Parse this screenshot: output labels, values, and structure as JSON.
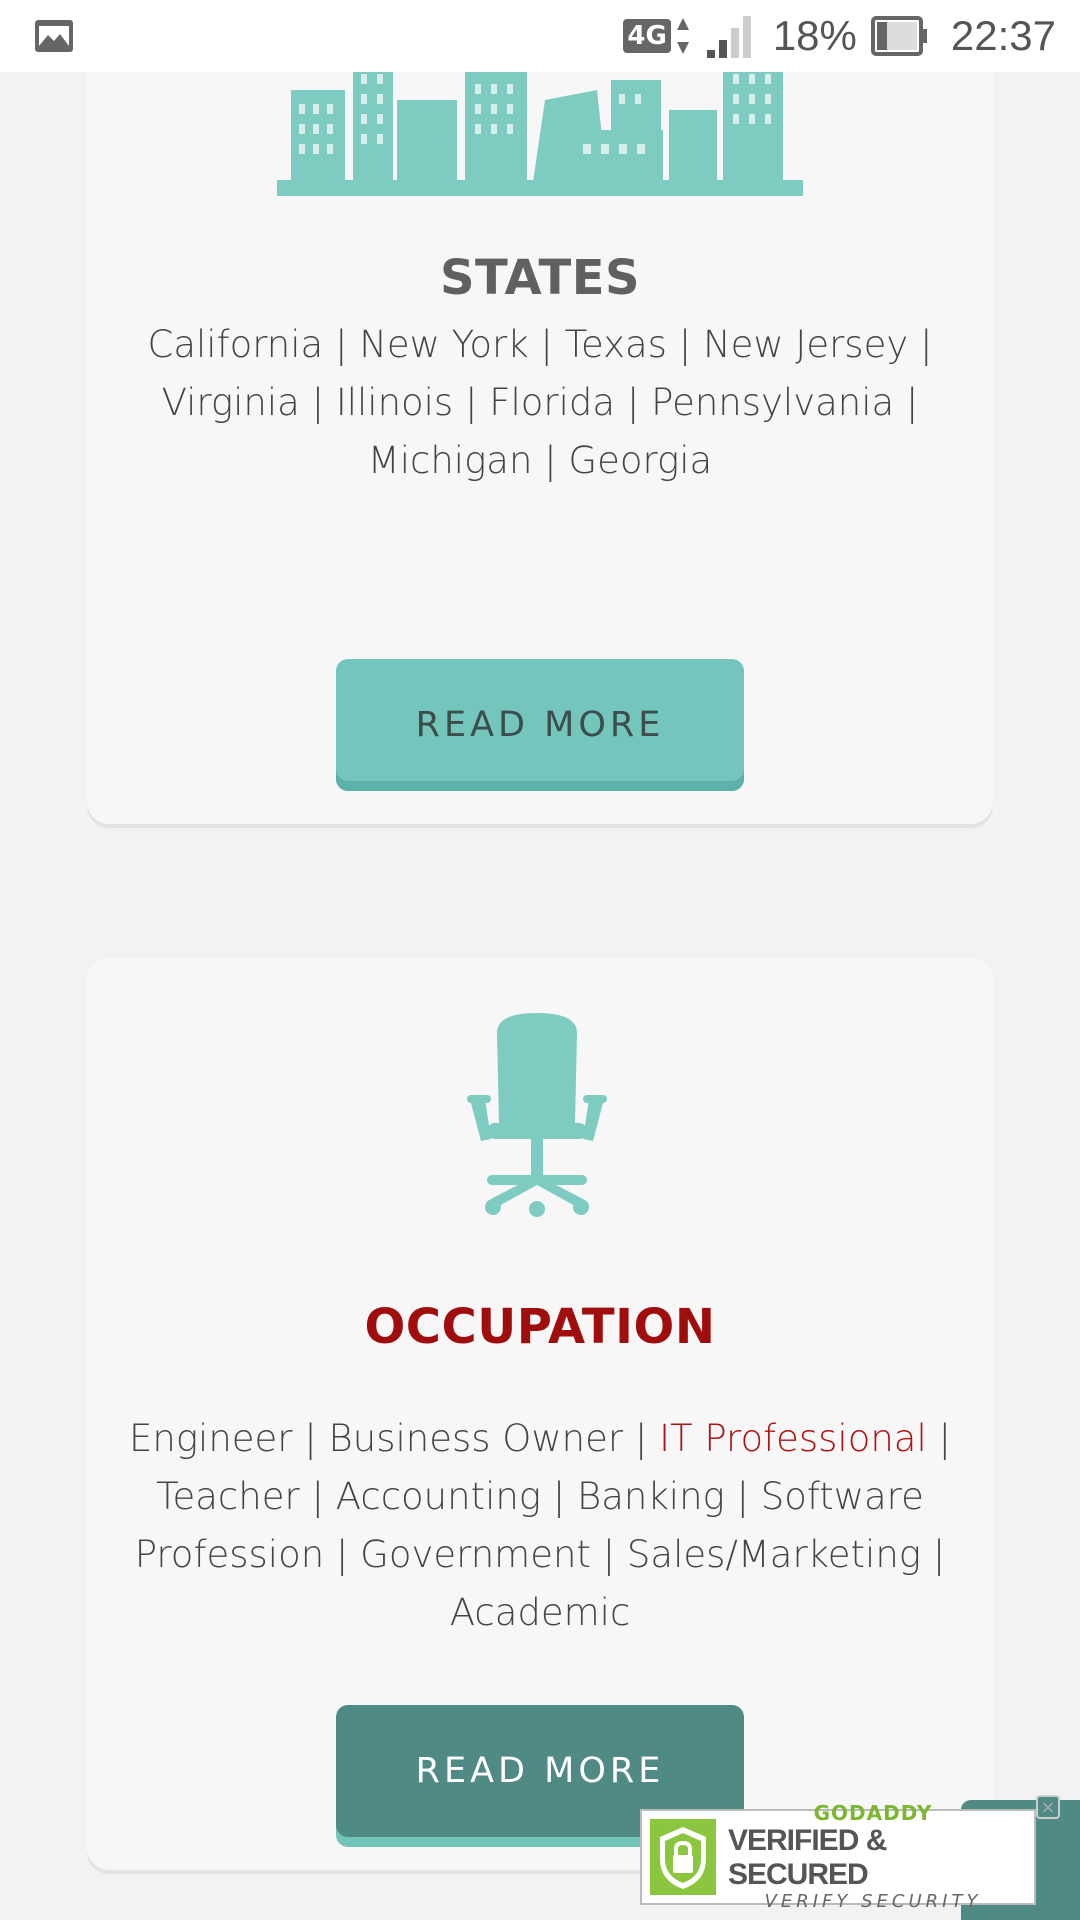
{
  "status_bar": {
    "network": "4G",
    "battery": "18%",
    "time": "22:37"
  },
  "cards": [
    {
      "title": "STATES",
      "illustration": "city-skyline",
      "items": [
        "California",
        "New York",
        "Texas",
        "New Jersey",
        "Virginia",
        "Illinois",
        "Florida",
        "Pennsylvania",
        "Michigan",
        "Georgia"
      ],
      "button": "READ MORE"
    },
    {
      "title": "OCCUPATION",
      "illustration": "office-chair",
      "items": [
        "Engineer",
        "Business Owner",
        "IT Professional",
        "Teacher",
        "Accounting",
        "Banking",
        "Software Profession",
        "Government",
        "Sales/Marketing",
        "Academic"
      ],
      "highlighted_item": "IT Professional",
      "button": "READ MORE"
    }
  ],
  "badge": {
    "brand": "GODADDY",
    "main": "VERIFIED & SECURED",
    "sub": "VERIFY SECURITY"
  },
  "colors": {
    "teal": "#74c6bd",
    "dark_teal": "#4f8a84",
    "accent_red": "#a00d0d",
    "title_gray": "#606060"
  }
}
